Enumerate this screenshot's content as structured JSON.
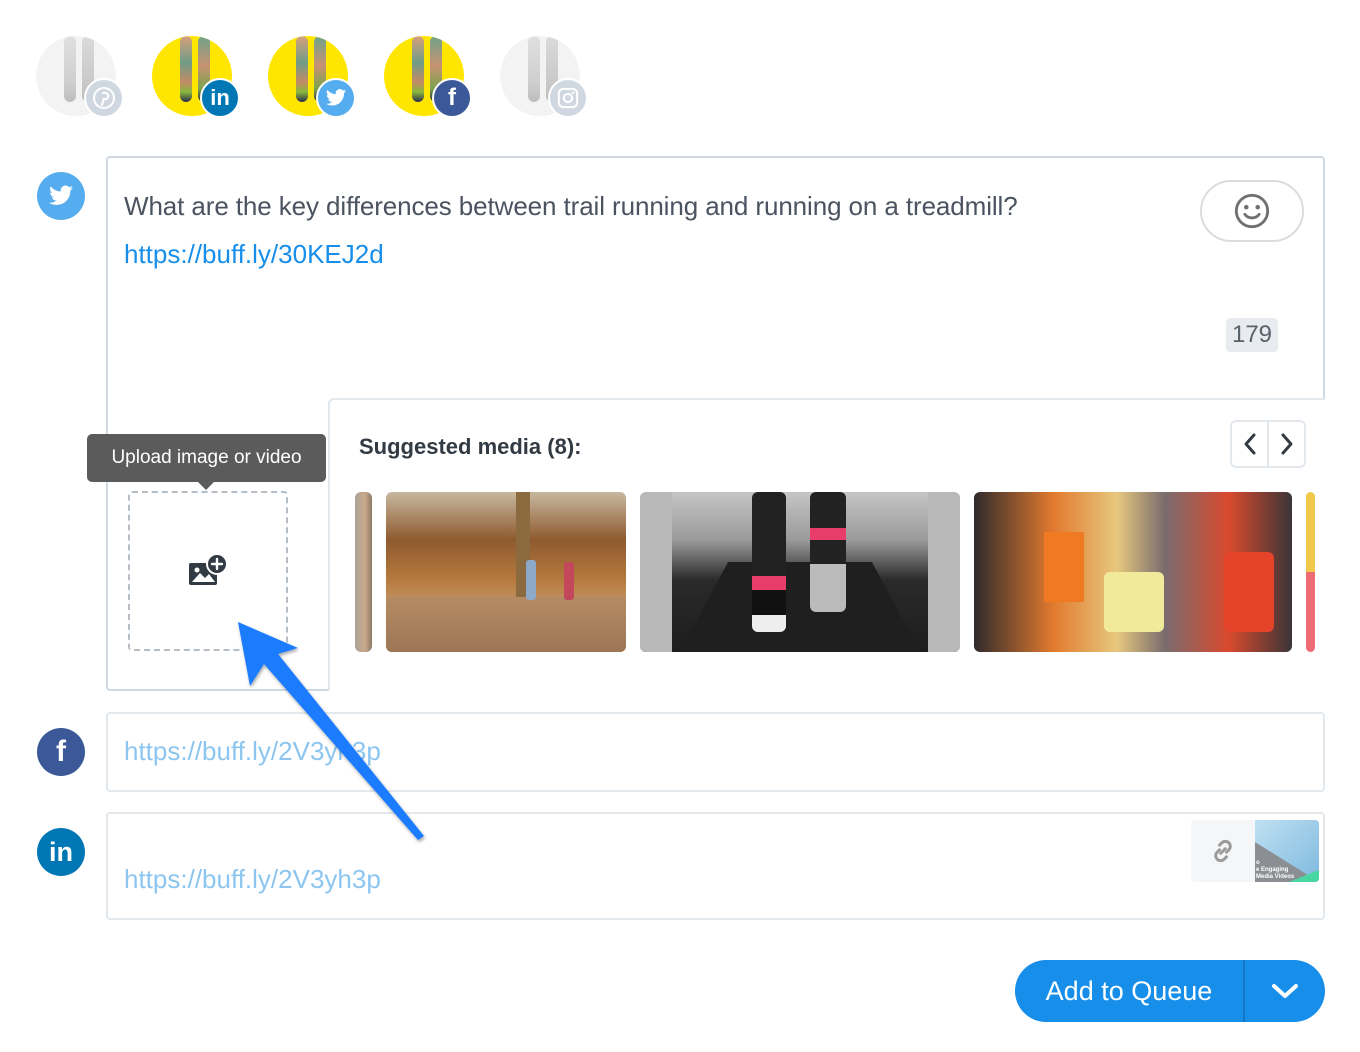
{
  "profiles": [
    {
      "network": "pinterest",
      "active": false,
      "badge_color": "#cfd7e0",
      "icon": "pinterest-icon"
    },
    {
      "network": "linkedin",
      "active": true,
      "badge_color": "#0077b5",
      "icon": "linkedin-icon"
    },
    {
      "network": "twitter",
      "active": true,
      "badge_color": "#55acee",
      "icon": "twitter-icon"
    },
    {
      "network": "facebook",
      "active": true,
      "badge_color": "#3b5998",
      "icon": "facebook-icon"
    },
    {
      "network": "instagram",
      "active": false,
      "badge_color": "#cfd7e0",
      "icon": "instagram-icon"
    }
  ],
  "twitter_composer": {
    "text": "What are the key differences between trail running and running on a treadmill?",
    "link": "https://buff.ly/30KEJ2d",
    "char_count": "179",
    "emoji_icon": "smiley-icon"
  },
  "upload": {
    "tooltip": "Upload image or video",
    "icon": "add-image-icon"
  },
  "suggested_media": {
    "title": "Suggested media (8):",
    "items": [
      {
        "description": "partial trail image"
      },
      {
        "description": "two runners on autumn forest trail"
      },
      {
        "description": "runner feet on treadmill"
      },
      {
        "description": "women racing in marathon"
      },
      {
        "description": "partial colorful image"
      }
    ],
    "prev_label": "‹",
    "next_label": "›"
  },
  "facebook_row": {
    "link": "https://buff.ly/2V3yh3p"
  },
  "linkedin_row": {
    "link": "https://buff.ly/2V3yh3p",
    "preview_text": "o\ne Engaging\nMedia Videos"
  },
  "actions": {
    "add_to_queue": "Add to Queue"
  },
  "colors": {
    "accent": "#168eea",
    "twitter": "#55acee",
    "facebook": "#3b5998",
    "linkedin": "#0077b5",
    "annotation_arrow": "#1a7bff"
  }
}
